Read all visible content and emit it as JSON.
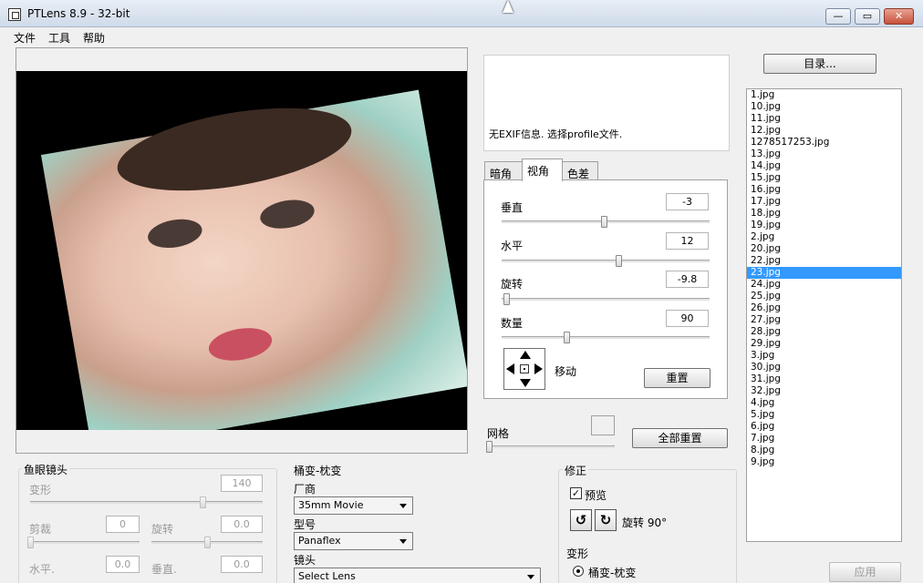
{
  "window": {
    "title": "PTLens 8.9 - 32-bit",
    "min_label": "—",
    "max_label": "▭",
    "close_label": "✕"
  },
  "menu": [
    "文件",
    "工具",
    "帮助"
  ],
  "exif": {
    "text": "无EXIF信息. 选择profile文件."
  },
  "tabs": [
    "暗角",
    "视角",
    "色差"
  ],
  "perspective": {
    "vertical": {
      "label": "垂直",
      "value": "-3",
      "level": 0.49
    },
    "horizontal": {
      "label": "水平",
      "value": "12",
      "level": 0.56
    },
    "rotate": {
      "label": "旋转",
      "value": "-9.8",
      "level": 0.02
    },
    "amount": {
      "label": "数量",
      "value": "90",
      "level": 0.31
    },
    "move_label": "移动",
    "reset_label": "重置"
  },
  "grid": {
    "label": "网格",
    "level": 0.0,
    "reset_all_label": "全部重置"
  },
  "directory_button": "目录...",
  "files": [
    "1.jpg",
    "10.jpg",
    "11.jpg",
    "12.jpg",
    "1278517253.jpg",
    "13.jpg",
    "14.jpg",
    "15.jpg",
    "16.jpg",
    "17.jpg",
    "18.jpg",
    "19.jpg",
    "2.jpg",
    "20.jpg",
    "22.jpg",
    "23.jpg",
    "24.jpg",
    "25.jpg",
    "26.jpg",
    "27.jpg",
    "28.jpg",
    "29.jpg",
    "3.jpg",
    "30.jpg",
    "31.jpg",
    "32.jpg",
    "4.jpg",
    "5.jpg",
    "6.jpg",
    "7.jpg",
    "8.jpg",
    "9.jpg"
  ],
  "selected_file": "23.jpg",
  "apply_label": "应用",
  "fisheye": {
    "title": "鱼眼镜头",
    "distort": {
      "label": "变形",
      "value": "140",
      "level": 0.74
    },
    "shear": {
      "label": "剪裁",
      "value": "0",
      "level": 0.0
    },
    "rotate": {
      "label": "旋转",
      "value": "0.0",
      "level": 0.5
    },
    "horiz": {
      "label": "水平.",
      "value": "0.0"
    },
    "vert": {
      "label": "垂直.",
      "value": "0.0"
    }
  },
  "barrel": {
    "title": "桶变-枕变",
    "vendor_label": "厂商",
    "vendor_value": "35mm Movie",
    "model_label": "型号",
    "model_value": "Panaflex",
    "lens_label": "镜头",
    "lens_value": "Select Lens"
  },
  "correct": {
    "title": "修正",
    "preview_label": "预览",
    "preview_checked": true,
    "rotate90_label": "旋转 90°",
    "transform_label": "变形",
    "radio_label": "桶变-枕变"
  },
  "colors": {
    "selection": "#3399ff",
    "accent_close": "#c7513a"
  }
}
